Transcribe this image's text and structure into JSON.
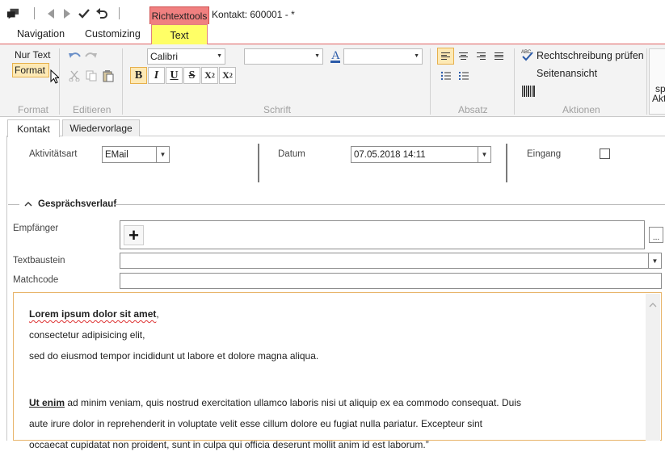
{
  "window": {
    "context_tab": "Richtexttools",
    "title": "Kontakt: 600001 -  *"
  },
  "ribbon_tabs": {
    "navigation": "Navigation",
    "customizing": "Customizing",
    "text": "Text"
  },
  "ribbon": {
    "format": {
      "nur_text": "Nur Text",
      "format": "Format",
      "label": "Format"
    },
    "editieren": {
      "label": "Editieren"
    },
    "schrift": {
      "font": "Calibri",
      "size": "",
      "color": "",
      "label": "Schrift",
      "bold": "B",
      "italic": "I",
      "underline": "U",
      "strike": "S",
      "sub_base": "X",
      "sub_mark": "2",
      "sup_base": "X",
      "sup_mark": "2"
    },
    "absatz": {
      "label": "Absatz"
    },
    "aktionen": {
      "spellcheck": "Rechtschreibung prüfen",
      "preview": "Seitenansicht",
      "label": "Aktionen"
    },
    "overflow": {
      "line1": "sp",
      "line2": "Akt"
    }
  },
  "doc_tabs": {
    "kontakt": "Kontakt",
    "wiedervorlage": "Wiedervorlage"
  },
  "form": {
    "aktivitaetsart_label": "Aktivitätsart",
    "aktivitaetsart_value": "EMail",
    "datum_label": "Datum",
    "datum_value": "07.05.2018 14:11",
    "eingang_label": "Eingang",
    "section_title": "Gesprächsverlauf",
    "empfaenger_label": "Empfänger",
    "textbaustein_label": "Textbaustein",
    "matchcode_label": "Matchcode",
    "add_symbol": "+",
    "more_symbol": "..."
  },
  "editor": {
    "p1_bold": "Lorem ipsum dolor sit amet",
    "p1_comma": ",",
    "p1_line2": "consectetur adipisicing elit,",
    "p1_line3": "sed do eiusmod tempor incididunt ut labore et dolore magna aliqua.",
    "p2_bold": "Ut enim",
    "p2_line1": " ad minim veniam, quis nostrud exercitation ullamco laboris nisi ut aliquip ex ea commodo consequat. Duis",
    "p2_line2": "aute irure dolor in reprehenderit in voluptate velit esse cillum dolore eu fugiat nulla pariatur. Excepteur sint",
    "p2_line3": "occaecat cupidatat non proident, sunt in culpa qui officia deserunt mollit anim id est laborum.”"
  }
}
